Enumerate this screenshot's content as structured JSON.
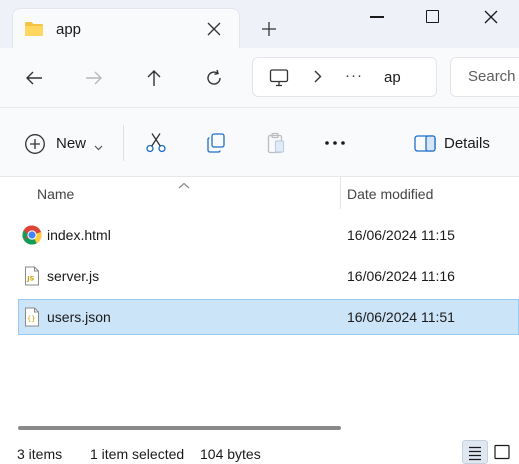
{
  "window": {
    "tab_title": "app",
    "icons": {
      "tab": "folder-icon",
      "close_tab": "close-icon",
      "new_tab": "plus-icon",
      "minimize": "minimize-icon",
      "maximize": "maximize-icon",
      "close": "close-icon"
    }
  },
  "nav": {
    "address_overflow": "···",
    "address_current": "ap",
    "search_placeholder": "Search",
    "icons": [
      "back-arrow-icon",
      "forward-arrow-icon",
      "up-arrow-icon",
      "refresh-icon",
      "this-pc-icon"
    ]
  },
  "commands": {
    "new_label": "New",
    "details_label": "Details",
    "icons": [
      "cut-icon",
      "copy-icon",
      "paste-icon",
      "more-icon",
      "details-pane-icon"
    ]
  },
  "columns": {
    "name": "Name",
    "date_modified": "Date modified"
  },
  "files": [
    {
      "name": "index.html",
      "date": "16/06/2024 11:15",
      "icon": "chrome-html-icon",
      "selected": false
    },
    {
      "name": "server.js",
      "date": "16/06/2024 11:16",
      "icon": "js-file-icon",
      "selected": false
    },
    {
      "name": "users.json",
      "date": "16/06/2024 11:51",
      "icon": "json-file-icon",
      "selected": true
    }
  ],
  "status": {
    "item_count": "3 items",
    "selection": "1 item selected",
    "size": "104 bytes",
    "view_icons": [
      "details-view-icon",
      "tiles-view-icon"
    ]
  },
  "colors": {
    "selection_fill": "#cce4f7",
    "selection_border": "#99c9ef",
    "titlebar_bg": "#eef2f8",
    "toolbar_bg": "#f9fafc",
    "accent_blue": "#1f6fc5"
  }
}
